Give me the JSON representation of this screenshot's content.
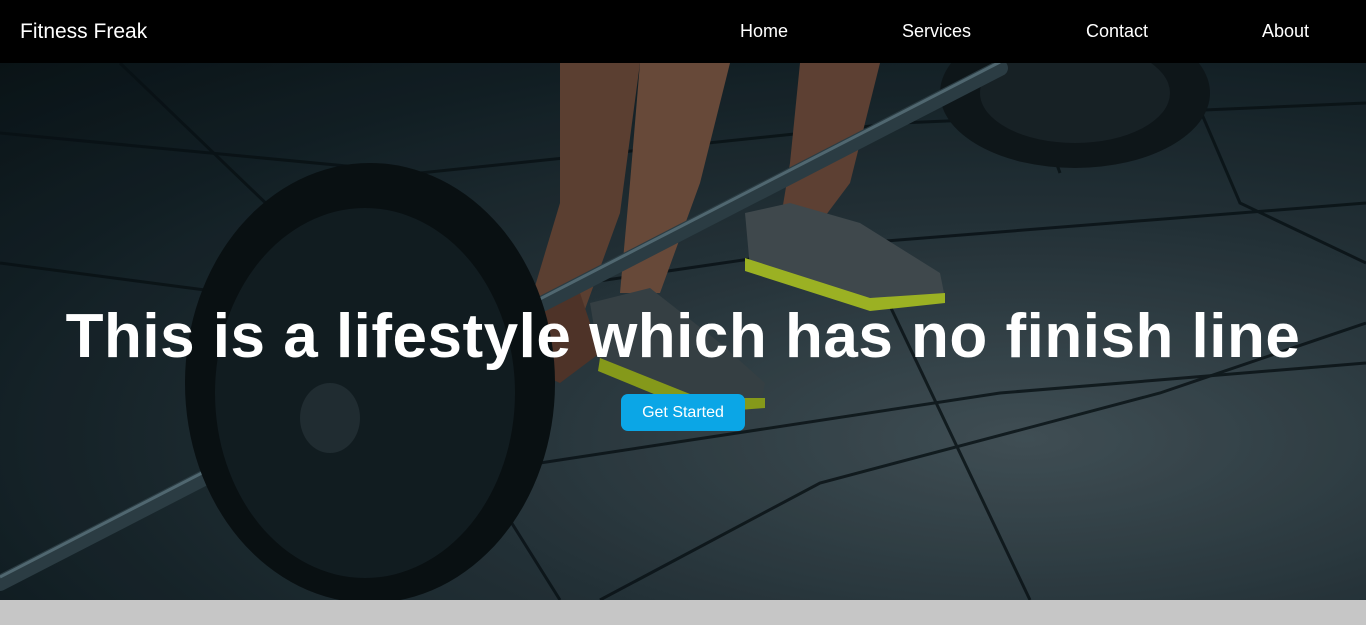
{
  "navbar": {
    "brand": "Fitness Freak",
    "links": [
      "Home",
      "Services",
      "Contact",
      "About"
    ]
  },
  "hero": {
    "title": "This is a lifestyle which has no finish line",
    "cta_label": "Get Started",
    "background": "Barbell deadlift on gym floor photo"
  },
  "colors": {
    "navbar": "#000000",
    "cta": "#0ba6e6",
    "footer_strip": "#c6c6c6",
    "shoe_accent": "#b7d12a"
  }
}
